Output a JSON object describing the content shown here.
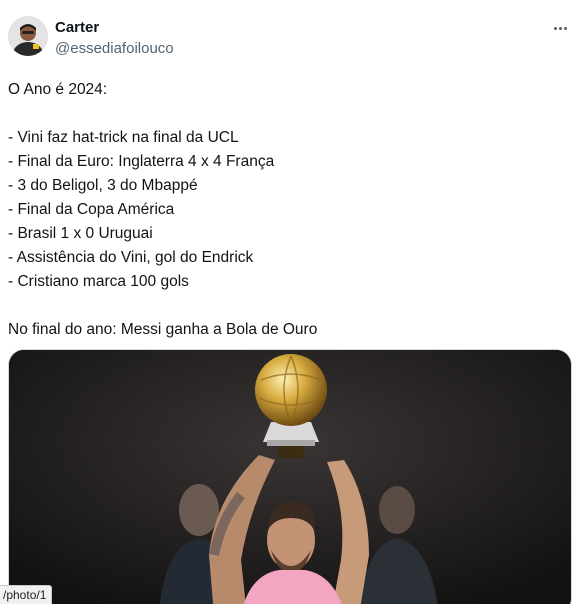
{
  "author": {
    "display_name": "Carter",
    "handle": "@essediafoilouco",
    "avatar_icon": "profile-avatar"
  },
  "more_icon": "more-options-icon",
  "tweet": {
    "intro": "O Ano é 2024:",
    "items": [
      "- Vini faz hat-trick na final da UCL",
      "- Final da Euro: Inglaterra 4 x 4 França",
      "- 3 do Beligol, 3 do Mbappé",
      "- Final da Copa América",
      "- Brasil 1 x 0 Uruguai",
      "- Assistência do Vini, gol do Endrick",
      "- Cristiano marca 100 gols"
    ],
    "conclusion": "No final do ano: Messi ganha a Bola de Ouro"
  },
  "media": {
    "kind": "photo",
    "subject": "player-lifting-golden-ball-trophy"
  },
  "status_bar": {
    "url_text": "/photo/1"
  },
  "colors": {
    "text": "#0f1419",
    "secondary": "#536471",
    "shirt": "#f2a6c2",
    "trophy": "#c9a23a"
  }
}
